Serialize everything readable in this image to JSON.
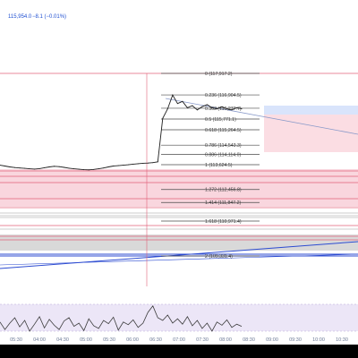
{
  "header": {
    "price_text": "115,954.0",
    "change_text": "−8.1 (−0.01%)"
  },
  "colors": {
    "background": "#ffffff",
    "frame": "#000000",
    "price_line": "#1f1f1f",
    "rsi_line": "#3a3a3a",
    "fib_line": "#4a4a4a",
    "fib_text": "#3a3a3a",
    "level_red": "#e0627a",
    "level_blue": "#2c4bd1",
    "level_gray": "#9a9a9a",
    "zone_pink": "#f9d6de",
    "zone_gray": "#cfcfcf",
    "box_blue": "#d9e4fb",
    "box_pink": "#fbdde3",
    "trend_line": "#8899c9",
    "rsi_band": "#ece6f7",
    "rsi_band_border": "#b7a8d8",
    "axis_text": "#6c7a96"
  },
  "chart_data": {
    "type": "line",
    "series": [
      {
        "values": [
          113600,
          113560,
          113520,
          113490,
          113470,
          113450,
          113430,
          113420,
          113440,
          113480,
          113520,
          113550,
          113530,
          113500,
          113460,
          113430,
          113410,
          113390,
          113380,
          113400,
          113430,
          113470,
          113520,
          113560,
          113580,
          113600,
          113620,
          113650,
          113670,
          113690,
          113700,
          113720,
          113760,
          115800,
          116250,
          116900,
          116500,
          116600,
          116300,
          116400,
          116200,
          116350,
          116450,
          116300,
          116250,
          116350,
          116250,
          116200,
          116300,
          116250
        ]
      }
    ],
    "fib_levels": [
      {
        "ratio": "0",
        "price": 117917.2,
        "label": "0 (117,917.2)"
      },
      {
        "ratio": "0.236",
        "price": 116904.5,
        "label": "0.236 (116,904.5)"
      },
      {
        "ratio": "0.382",
        "price": 116277.7,
        "label": "0.382 (116,277.7)"
      },
      {
        "ratio": "0.5",
        "price": 115771.1,
        "label": "0.5 (115,771.1)"
      },
      {
        "ratio": "0.618",
        "price": 115264.5,
        "label": "0.618 (115,264.5)"
      },
      {
        "ratio": "0.786",
        "price": 114543.3,
        "label": "0.786 (114,543.3)"
      },
      {
        "ratio": "0.886",
        "price": 114114.0,
        "label": "0.886 (114,114.0)"
      },
      {
        "ratio": "1",
        "price": 113624.5,
        "label": "1 (113,624.5)"
      },
      {
        "ratio": "1.272",
        "price": 112456.8,
        "label": "1.272 (112,456.8)"
      },
      {
        "ratio": "1.414",
        "price": 111847.2,
        "label": "1.414 (111,847.2)"
      },
      {
        "ratio": "1.618",
        "price": 110971.4,
        "label": "1.618 (110,971.4)"
      },
      {
        "ratio": "2",
        "price": 109331.4,
        "label": "2 (109,331.4)"
      }
    ],
    "x_tick_labels": [
      "05:30",
      "04:00",
      "04:30",
      "05:00",
      "05:30",
      "06:00",
      "06:30",
      "07:00",
      "07:30",
      "08:00",
      "08:30",
      "09:00",
      "09:30",
      "10:00",
      "10:30"
    ],
    "rsi_values": [
      52,
      38,
      50,
      60,
      43,
      55,
      35,
      48,
      62,
      41,
      57,
      46,
      38,
      54,
      60,
      44,
      50,
      36,
      58,
      45,
      40,
      55,
      49,
      61,
      37,
      52,
      47,
      56,
      42,
      50,
      70,
      82,
      60,
      55,
      65,
      50,
      58,
      48,
      62,
      45,
      55,
      40,
      50,
      35,
      52,
      46,
      56,
      42,
      48,
      44
    ],
    "ylim": [
      108700,
      119200
    ]
  }
}
